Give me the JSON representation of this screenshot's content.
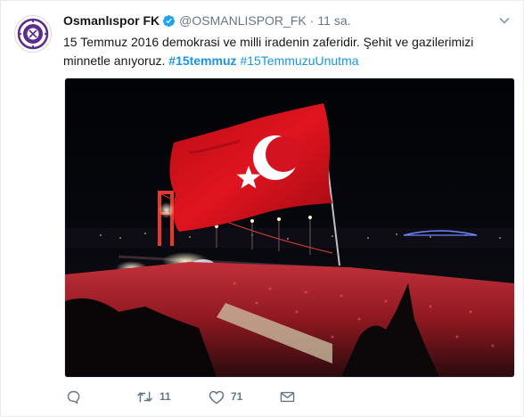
{
  "tweet": {
    "display_name": "Osmanlıspor FK",
    "handle": "@OSMANLISPOR_FK",
    "separator": "·",
    "time": "11 sa.",
    "text_line1": "15 Temmuz 2016 demokrasi ve milli iradenin zaferidir. Şehit ve gazilerimizi",
    "text_line2_prefix": "minnetle anıyoruz. ",
    "hashtag1": "#15temmuz",
    "hashtag2": "#15TemmuzuUnutma"
  },
  "actions": {
    "retweet_count": "11",
    "like_count": "71"
  },
  "icons": {
    "verified": "verified-badge-icon",
    "caret": "chevron-down-icon",
    "reply": "reply-icon",
    "retweet": "retweet-icon",
    "like": "heart-icon",
    "dm": "envelope-icon"
  },
  "colors": {
    "link": "#1b95e0",
    "muted": "#657786",
    "verified": "#1da1f2",
    "brand_purple": "#5b2d8e",
    "flag_red": "#d8121e"
  }
}
